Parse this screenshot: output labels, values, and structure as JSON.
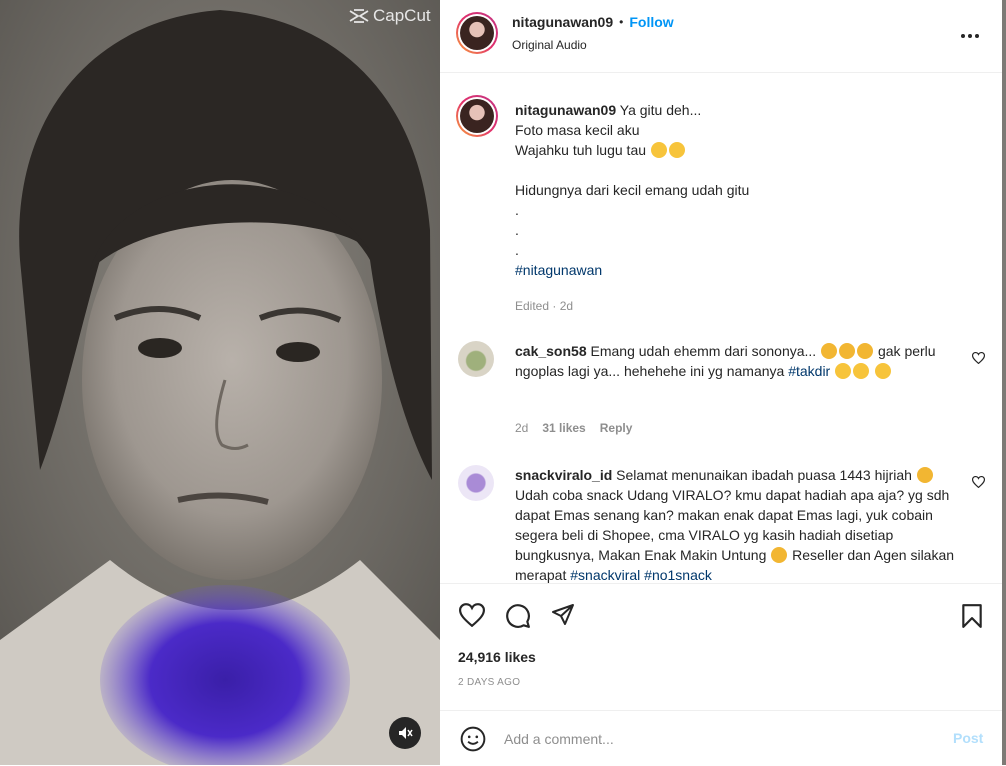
{
  "media": {
    "watermark": "CapCut",
    "mute_icon": "speaker-muted-icon"
  },
  "header": {
    "username": "nitagunawan09",
    "separator": "•",
    "follow_label": "Follow",
    "audio_label": "Original Audio",
    "more_icon": "more-horizontal-icon"
  },
  "caption": {
    "username": "nitagunawan09",
    "lines": [
      "Ya gitu deh...",
      "Foto masa kecil aku",
      "Wajahku tuh lugu tau",
      "",
      "Hidungnya dari kecil emang udah gitu",
      ".",
      ".",
      "."
    ],
    "hashtag": "#nitagunawan",
    "meta": "Edited · 2d"
  },
  "comments": [
    {
      "username": "cak_son58",
      "text": "Emang udah ehemm dari sononya...",
      "text2": "gak perlu ngoplas lagi ya... hehehehe ini yg namanya",
      "hashtag": "#takdir",
      "time": "2d",
      "likes": "31 likes",
      "reply": "Reply"
    },
    {
      "username": "snackviralo_id",
      "text": "Selamat menunaikan ibadah puasa 1443 hijriah",
      "text2": "Udah coba snack Udang VIRALO? kmu dapat hadiah apa aja? yg sdh dapat Emas senang kan? makan enak dapat Emas lagi, yuk cobain segera beli di Shopee, cma VIRALO yg kasih hadiah disetiap bungkusnya, Makan Enak Makin Untung",
      "text3": "Reseller dan Agen silakan merapat",
      "hashtags": "#snackviral #no1snack"
    }
  ],
  "actions": {
    "like_icon": "heart-icon",
    "comment_icon": "comment-icon",
    "share_icon": "share-icon",
    "save_icon": "bookmark-icon"
  },
  "likes": "24,916 likes",
  "date": "2 DAYS AGO",
  "composer": {
    "emoji_icon": "emoji-icon",
    "placeholder": "Add a comment...",
    "post_label": "Post"
  },
  "colors": {
    "accent": "#0095f6",
    "post_disabled": "#b2dffc",
    "hashtag": "#00376b",
    "muted": "#8e8e8e"
  }
}
